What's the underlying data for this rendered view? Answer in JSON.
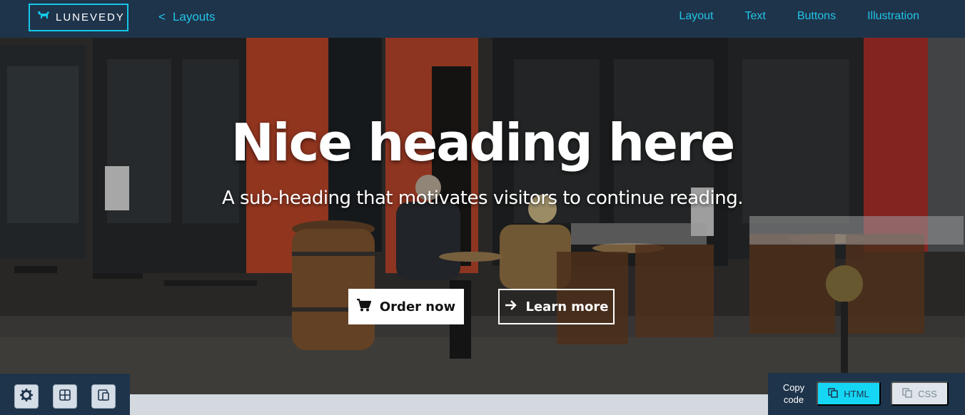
{
  "brand": {
    "name": "LUNEVEDY",
    "accent": "#15c7e8",
    "navbar_bg": "#1e344b"
  },
  "back_link": {
    "chevron": "<",
    "label": "Layouts"
  },
  "nav": {
    "items": [
      {
        "label": "Layout"
      },
      {
        "label": "Text"
      },
      {
        "label": "Buttons"
      },
      {
        "label": "Illustration"
      }
    ]
  },
  "hero": {
    "title": "Nice heading here",
    "subtitle": "A sub-heading that motivates visitors to continue reading.",
    "primary_button": {
      "label": "Order now",
      "icon": "cart-icon"
    },
    "secondary_button": {
      "label": "Learn more",
      "icon": "arrow-right-icon"
    }
  },
  "tools": {
    "left": [
      {
        "icon": "gear-icon"
      },
      {
        "icon": "grid-icon"
      },
      {
        "icon": "mobile-view-icon"
      }
    ],
    "copy_label_line1": "Copy",
    "copy_label_line2": "code",
    "html_button": {
      "label": "HTML",
      "icon": "copy-icon",
      "color": "#15d6f5"
    },
    "css_button": {
      "label": "CSS",
      "icon": "copy-icon"
    }
  }
}
